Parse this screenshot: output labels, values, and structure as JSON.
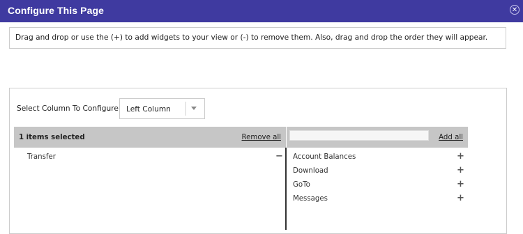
{
  "dialog": {
    "title": "Configure This Page",
    "close_symbol": "✕"
  },
  "instructions": "Drag and drop or use the (+) to add widgets to your view or (-) to remove them. Also, drag and drop the order they will appear.",
  "column_select": {
    "label": "Select Column To Configure:",
    "selected": "Left Column"
  },
  "selected_widgets": {
    "count_label": "1 items selected",
    "remove_all_label": "Remove all",
    "items": [
      {
        "label": "Transfer",
        "action": "−"
      }
    ]
  },
  "available_widgets": {
    "filter_value": "",
    "add_all_label": "Add all",
    "items": [
      {
        "label": "Account Balances",
        "action": "+"
      },
      {
        "label": "Download",
        "action": "+"
      },
      {
        "label": "GoTo",
        "action": "+"
      },
      {
        "label": "Messages",
        "action": "+"
      }
    ]
  },
  "colors": {
    "titlebar": "#3f3aa0",
    "list_header": "#c6c6c6",
    "border": "#cccccc"
  }
}
